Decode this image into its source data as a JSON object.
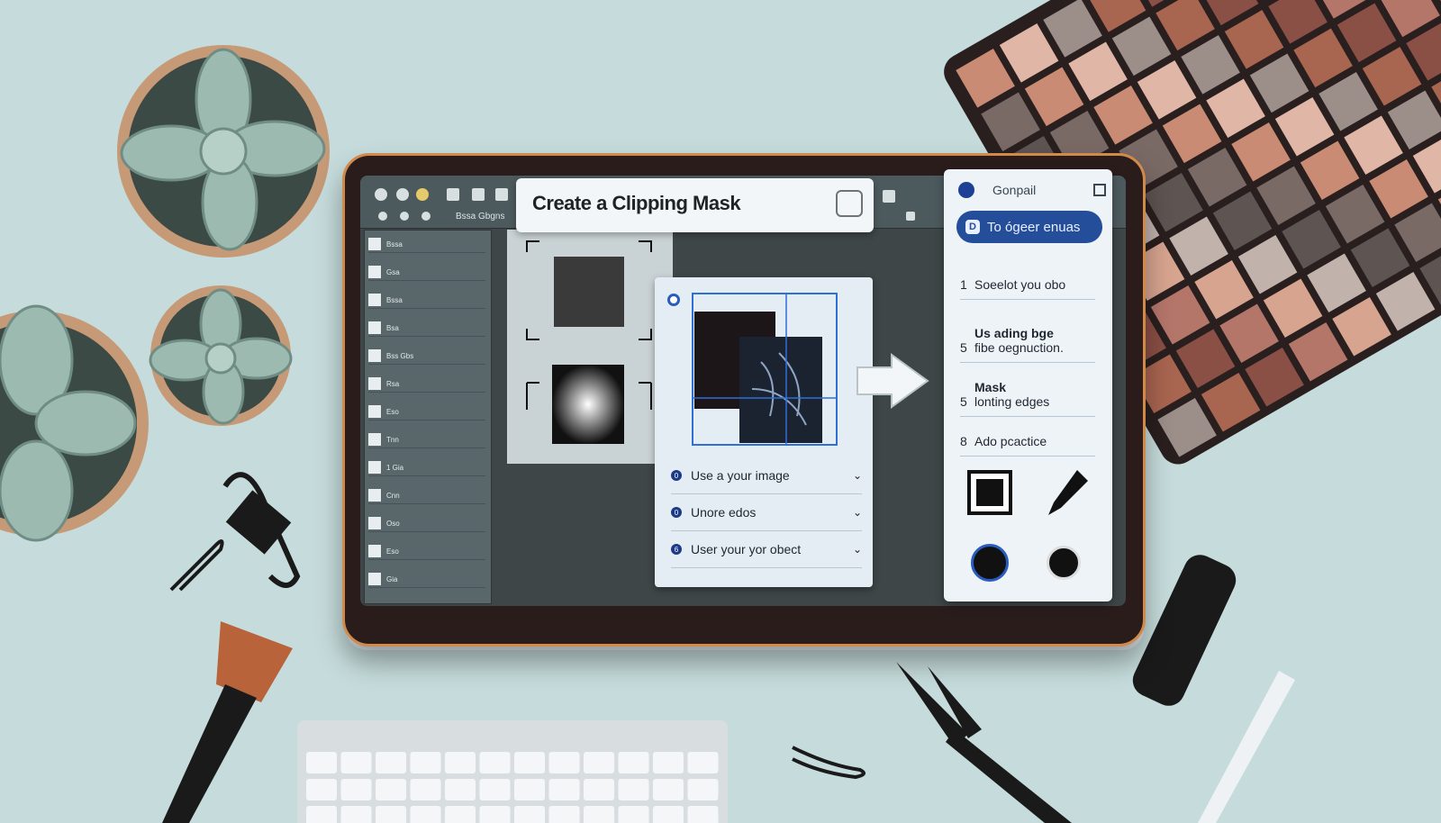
{
  "app": {
    "title": "Create a Clipping Mask",
    "toolbar_label": "Bssa Gbgns"
  },
  "left_panel": {
    "rows": [
      "Bssa",
      "Gsa",
      "Bssa",
      "Bsa",
      "Bss Gbs",
      "Rsa",
      "Eso",
      "Tnn",
      "1 Gia",
      "Cnn",
      "Oso",
      "Eso",
      "Gia"
    ]
  },
  "card": {
    "items": [
      {
        "badge": "0",
        "label": "Use a your image"
      },
      {
        "badge": "0",
        "label": "Unore edos"
      },
      {
        "badge": "6",
        "label": "User your yor obect"
      }
    ]
  },
  "right_panel": {
    "header": "Gonpail",
    "primary_button": "To ógeer enuas",
    "primary_badge": "D",
    "steps": [
      {
        "num": "1",
        "title": "",
        "text": "Soeelot you obo"
      },
      {
        "num": "5",
        "title": "Us ading bge",
        "text": "fibe oegnuction."
      },
      {
        "num": "5",
        "title": "Mask",
        "text": "lonting edges"
      },
      {
        "num": "8",
        "title": "",
        "text": "Ado pcactice"
      }
    ]
  },
  "colors": {
    "accent": "#244d9a",
    "desk": "#c6dcdc",
    "tablet_frame": "#2b1c1c",
    "screen_bg": "#3e4648"
  },
  "icons": {
    "title_icon": "face-icon",
    "card_icon": "circle-icon",
    "arrow": "arrow-right-icon",
    "tools": [
      "square-icon",
      "brush-icon",
      "circle-icon",
      "circle-icon"
    ]
  }
}
